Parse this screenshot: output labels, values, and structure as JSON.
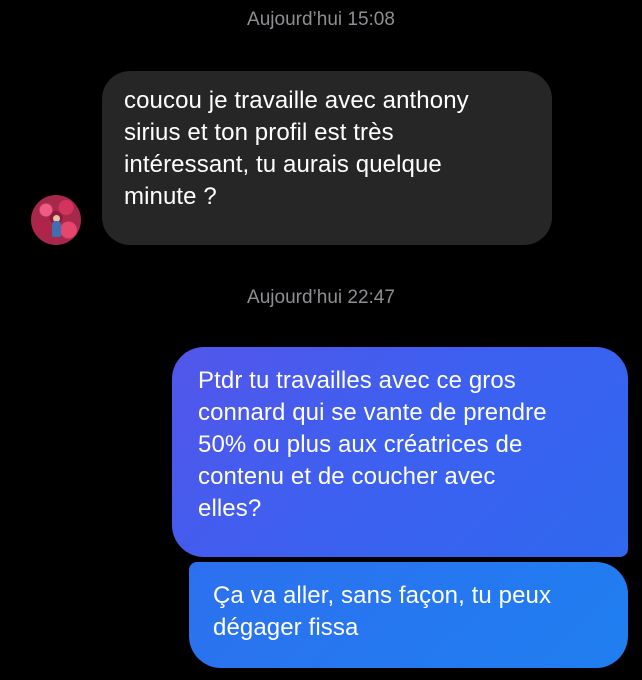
{
  "conversation": {
    "timestamps": [
      "Aujourd’hui 15:08",
      "Aujourd’hui 22:47"
    ],
    "messages": [
      {
        "direction": "incoming",
        "lines": [
          "coucou je travaille avec anthony",
          "sirius et ton profil est très",
          "intéressant, tu aurais quelque",
          "minute ?"
        ]
      },
      {
        "direction": "outgoing",
        "lines": [
          "Ptdr tu travailles avec ce gros",
          "connard qui se vante de prendre",
          "50% ou plus aux créatrices de",
          "contenu et de coucher avec",
          "elles?"
        ]
      },
      {
        "direction": "outgoing",
        "lines": [
          "Ça va aller, sans façon, tu peux",
          "dégager fissa"
        ]
      }
    ]
  },
  "colors": {
    "background": "#000000",
    "incoming_bubble": "#262626",
    "outgoing_bubble_start": "#5356ea",
    "outgoing_bubble_end": "#1f7ff0",
    "timestamp_text": "#8e8e93",
    "message_text": "#ffffff"
  }
}
